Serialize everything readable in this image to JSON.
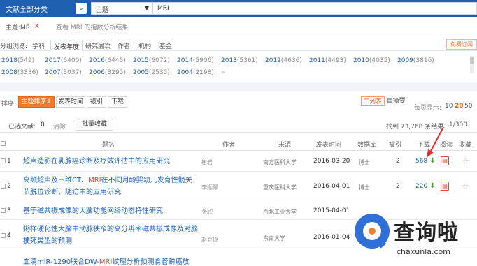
{
  "search": {
    "category_label": "文献全部分类",
    "field_value": "主题",
    "query_value": "MRI"
  },
  "query_info": {
    "tag": "主题:MRI",
    "close": "×",
    "trend_link": "查看 MRI 的指数分析结果"
  },
  "grouping": {
    "label": "分组浏览:",
    "tabs": [
      "学科",
      "发表年度",
      "研究层次",
      "作者",
      "机构",
      "基金"
    ],
    "active_index": 1,
    "free_subscribe": "免费订阅"
  },
  "years": {
    "row1": [
      {
        "year": "2018",
        "count": "(549)"
      },
      {
        "year": "2017",
        "count": "(6400)"
      },
      {
        "year": "2016",
        "count": "(6445)"
      },
      {
        "year": "2015",
        "count": "(6072)"
      },
      {
        "year": "2014",
        "count": "(5906)"
      },
      {
        "year": "2013",
        "count": "(5361)"
      },
      {
        "year": "2012",
        "count": "(4636)"
      },
      {
        "year": "2011",
        "count": "(4493)"
      },
      {
        "year": "2010",
        "count": "(4035)"
      },
      {
        "year": "2009",
        "count": "(3816)"
      }
    ],
    "row2": [
      {
        "year": "2008",
        "count": "(3336)"
      },
      {
        "year": "2007",
        "count": "(3037)"
      },
      {
        "year": "2006",
        "count": "(3295)"
      },
      {
        "year": "2005",
        "count": "(2535)"
      },
      {
        "year": "2004",
        "count": "(2198)"
      }
    ],
    "more": "»"
  },
  "sort": {
    "label": "排序:",
    "buttons": [
      "主题排序",
      "发表时间",
      "被引",
      "下载"
    ],
    "active_index": 0,
    "active_arrow": "↓",
    "view_list": "列表",
    "view_abstract": "摘要",
    "per_page_label": "每页显示:",
    "per_page": [
      "10",
      "20",
      "50"
    ],
    "per_page_active": 1
  },
  "selection": {
    "label": "已选文献:",
    "count": "0",
    "clear": "清除",
    "batch_button": "批量收藏",
    "found": "找到 73,768 条结果",
    "page": "1/300"
  },
  "table": {
    "headers": [
      "题名",
      "作者",
      "来源",
      "发表时间",
      "数据库",
      "被引",
      "下载",
      "阅读",
      "收藏"
    ],
    "rows": [
      {
        "num": "1",
        "title": "超声造影在乳腺癌诊断及疗效评估中的应用研究",
        "title_hl": "",
        "title_tail": "",
        "author": "崔岩",
        "source": "南方医科大学",
        "date": "2016-03-20",
        "db": "博士",
        "cited": "2",
        "downloads": "568"
      },
      {
        "num": "2",
        "title": "高频超声及三维CT、",
        "title_hl": "MRI",
        "title_tail": "在不同月龄婴幼儿发育性髋关节脱位诊断、随访中的应用研究",
        "author": "李顺琴",
        "source": "重庆医科大学",
        "date": "2016-04-01",
        "db": "博士",
        "cited": "2",
        "downloads": "220"
      },
      {
        "num": "3",
        "title": "基于磁共振成像的大脑功能网络动态特性研究",
        "title_hl": "",
        "title_tail": "",
        "author": "张欣",
        "source": "西北工业大学",
        "date": "2015-04-01",
        "db": "",
        "cited": "",
        "downloads": ""
      },
      {
        "num": "4",
        "title": "粥样硬化性大脑中动脉狭窄的高分辨率磁共振成像及对脑梗死类型的预测",
        "title_hl": "",
        "title_tail": "",
        "author": "赵登玲",
        "source": "东南大学",
        "date": "2016-01-04",
        "db": "",
        "cited": "",
        "downloads": ""
      },
      {
        "num": "",
        "title": "血清miR-1290联合DW-",
        "title_hl": "MRI",
        "title_tail": "纹理分析预测食管鳞癌放",
        "author": "",
        "source": "",
        "date": "",
        "db": "",
        "cited": "",
        "downloads": ""
      }
    ]
  },
  "watermark": {
    "cn": "查询啦",
    "en": "chaxunla.com"
  },
  "colors": {
    "header_blue": "#1f5fb0",
    "link_blue": "#1f5fb0",
    "accent_orange": "#f07c2e",
    "highlight_red": "#d54a3a",
    "download_green": "#3a9d2f"
  }
}
